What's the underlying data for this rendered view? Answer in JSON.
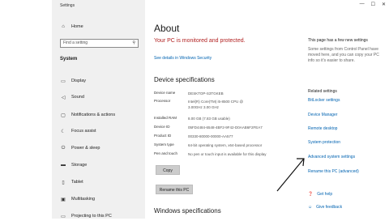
{
  "window": {
    "app_title": "Settings",
    "controls": [
      "—",
      "☐",
      "✕"
    ]
  },
  "sidebar": {
    "home_label": "Home",
    "search_placeholder": "Find a setting",
    "group_title": "System",
    "items": [
      {
        "label": "Display",
        "icon": "display-icon"
      },
      {
        "label": "Sound",
        "icon": "sound-icon"
      },
      {
        "label": "Notifications & actions",
        "icon": "notifications-icon"
      },
      {
        "label": "Focus assist",
        "icon": "focus-assist-icon"
      },
      {
        "label": "Power & sleep",
        "icon": "power-icon"
      },
      {
        "label": "Storage",
        "icon": "storage-icon"
      },
      {
        "label": "Tablet",
        "icon": "tablet-icon"
      },
      {
        "label": "Multitasking",
        "icon": "multitasking-icon"
      },
      {
        "label": "Projecting to this PC",
        "icon": "projecting-icon"
      }
    ]
  },
  "main": {
    "title": "About",
    "monitored_text": "Your PC is monitored and protected.",
    "security_link": "See details in Windows Security",
    "device_specs_heading": "Device specifications",
    "specs": [
      {
        "label": "Device name",
        "value": "DESKTOP-S3TGKEB"
      },
      {
        "label": "Processor",
        "value": "Intel(R) Core(TM) i5-8500 CPU @ 3.00GHz 3.00 GHz"
      },
      {
        "label": "Installed RAM",
        "value": "8.00 GB (7.83 GB usable)"
      },
      {
        "label": "Device ID",
        "value": "05FD4484-6548-4BF2-9F42-D0AAB6F2FEA7"
      },
      {
        "label": "Product ID",
        "value": "00330-80000-00000-AA577"
      },
      {
        "label": "System type",
        "value": "64-bit operating system, x64-based processor"
      },
      {
        "label": "Pen and touch",
        "value": "No pen or touch input is available for this display"
      }
    ],
    "copy_button": "Copy",
    "rename_button": "Rename this PC",
    "windows_specs_heading": "Windows specifications"
  },
  "right": {
    "new_settings_title": "This page has a few new settings",
    "new_settings_desc": "Some settings from Control Panel have moved here, and you can copy your PC info so it's easier to share.",
    "related_title": "Related settings",
    "links": [
      "BitLocker settings",
      "Device Manager",
      "Remote desktop",
      "System protection",
      "Advanced system settings",
      "Rename this PC (advanced)"
    ],
    "help_links": [
      {
        "label": "Get help",
        "icon": "help-icon"
      },
      {
        "label": "Give feedback",
        "icon": "feedback-icon"
      }
    ]
  },
  "colors": {
    "accent": "#0063b1",
    "warning": "#b22222",
    "sidebar_bg": "#f0f0f0"
  }
}
